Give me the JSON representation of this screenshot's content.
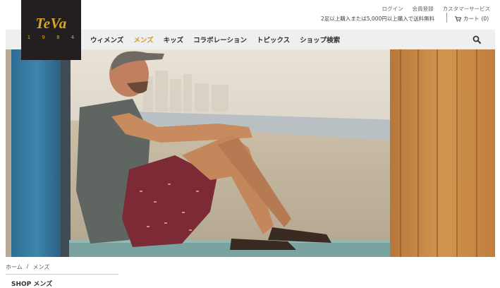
{
  "logo": {
    "word": "TeVa",
    "year": "1 9 8 4"
  },
  "utility_links": [
    "ログイン",
    "会員登録",
    "カスタマーサービス"
  ],
  "promo_text": "2足以上購入または5,000円以上購入で送料無料",
  "cart": {
    "label": "カート",
    "count": "(0)"
  },
  "nav": {
    "items": [
      "ウィメンズ",
      "メンズ",
      "キッズ",
      "コラボレーション",
      "トピックス",
      "ショップ検索"
    ],
    "active_index": 1,
    "active_color": "#d39b1b"
  },
  "icons": {
    "search": "search-icon",
    "cart": "cart-icon"
  },
  "breadcrumb": {
    "home": "ホーム",
    "separator": "/",
    "current": "メンズ"
  },
  "page_title": "SHOP メンズ",
  "colors": {
    "logo_bg": "#231f20",
    "logo_gold": "#d4a82a",
    "nav_bg": "#efefef"
  }
}
